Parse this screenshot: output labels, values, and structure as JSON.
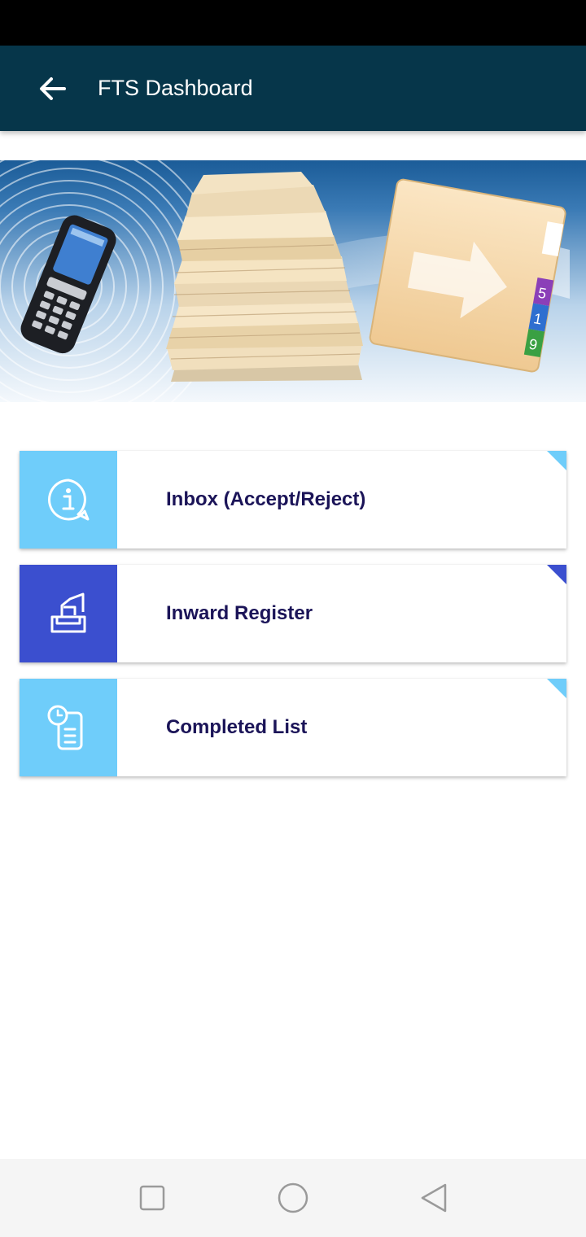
{
  "appbar": {
    "title": "FTS Dashboard",
    "back_icon": "arrow-left-icon",
    "background": "#06364a"
  },
  "banner": {
    "illustration": "handheld scanner, paper stack and file folder",
    "folder_tab_digits": [
      "5",
      "1",
      "9"
    ]
  },
  "menu": [
    {
      "label": "Inbox (Accept/Reject)",
      "icon": "info-chat-icon",
      "color": "#6fcdfa"
    },
    {
      "label": "Inward Register",
      "icon": "inward-tray-icon",
      "color": "#3b4fcf"
    },
    {
      "label": "Completed List",
      "icon": "clock-list-icon",
      "color": "#6fcdfa"
    }
  ],
  "navbar": {
    "items": [
      "recents-square-icon",
      "home-circle-icon",
      "back-triangle-icon"
    ]
  }
}
